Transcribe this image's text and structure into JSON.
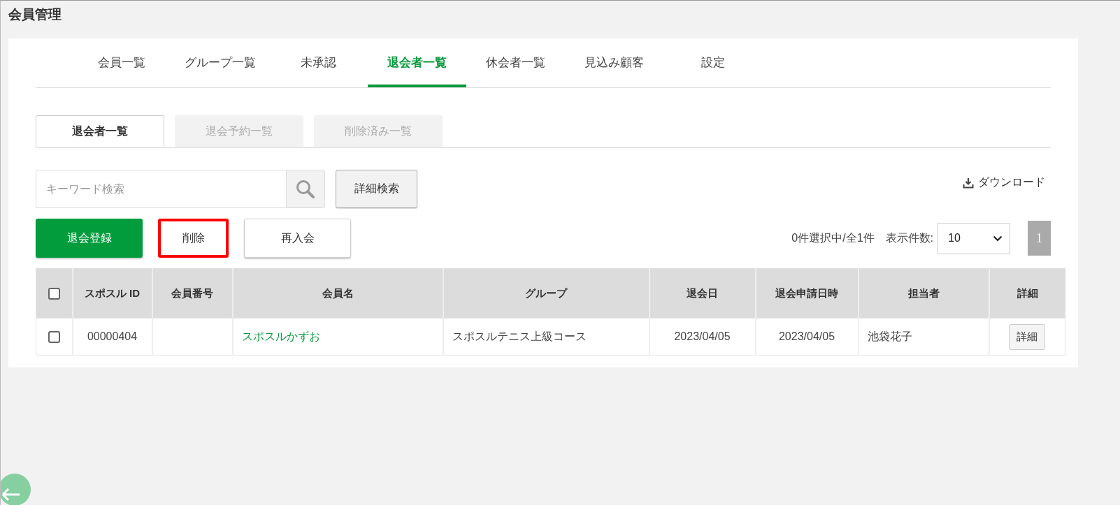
{
  "page_title": "会員管理",
  "tabs": [
    {
      "label": "会員一覧",
      "selected": false
    },
    {
      "label": "グループ一覧",
      "selected": false
    },
    {
      "label": "未承認",
      "selected": false
    },
    {
      "label": "退会者一覧",
      "selected": true
    },
    {
      "label": "休会者一覧",
      "selected": false
    },
    {
      "label": "見込み顧客",
      "selected": false
    },
    {
      "label": "設定",
      "selected": false
    }
  ],
  "sub_tabs": [
    {
      "label": "退会者一覧",
      "selected": true
    },
    {
      "label": "退会予約一覧",
      "selected": false
    },
    {
      "label": "削除済み一覧",
      "selected": false
    }
  ],
  "search": {
    "placeholder": "キーワード検索"
  },
  "advanced_search_button": "詳細検索",
  "download_link": "ダウンロード",
  "action_buttons": [
    {
      "label": "退会登録",
      "kind": "primary"
    },
    {
      "label": "削除",
      "kind": "highlighted"
    },
    {
      "label": "再入会",
      "kind": "default"
    }
  ],
  "selection_summary": "0件選択中/全1件",
  "page_size": {
    "label": "表示件数:",
    "value": "10"
  },
  "pagination": [
    {
      "label": "1",
      "selected": true
    }
  ],
  "table": {
    "select_all_checked": false,
    "columns": [
      "スポスル ID",
      "会員番号",
      "会員名",
      "グループ",
      "退会日",
      "退会申請日時",
      "担当者",
      "詳細"
    ],
    "rows": [
      {
        "checked": false,
        "spotsuru_id": "00000404",
        "member_name": "スポスルかずお",
        "group": "スポスルテニス上級コース",
        "withdrawal_date": "2023/04/05",
        "request_datetime": "2023/04/05",
        "staff": "池袋花子",
        "detail_button": "詳細"
      }
    ]
  }
}
